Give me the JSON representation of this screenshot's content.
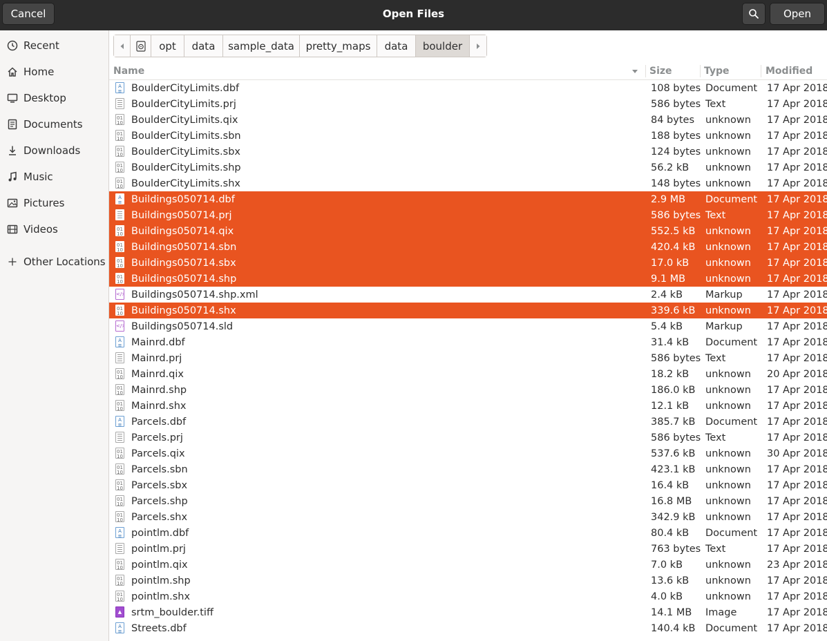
{
  "window": {
    "title": "Open Files",
    "cancel_label": "Cancel",
    "open_label": "Open"
  },
  "sidebar": {
    "items": [
      {
        "label": "Recent",
        "icon": "clock-icon"
      },
      {
        "label": "Home",
        "icon": "home-icon"
      },
      {
        "label": "Desktop",
        "icon": "desktop-icon"
      },
      {
        "label": "Documents",
        "icon": "documents-icon"
      },
      {
        "label": "Downloads",
        "icon": "download-icon"
      },
      {
        "label": "Music",
        "icon": "music-icon"
      },
      {
        "label": "Pictures",
        "icon": "pictures-icon"
      },
      {
        "label": "Videos",
        "icon": "videos-icon"
      },
      {
        "label": "Other Locations",
        "icon": "plus-icon"
      }
    ]
  },
  "path": {
    "crumbs": [
      "opt",
      "data",
      "sample_data",
      "pretty_maps",
      "data",
      "boulder"
    ]
  },
  "columns": {
    "name": "Name",
    "size": "Size",
    "type": "Type",
    "modified": "Modified"
  },
  "files": [
    {
      "name": "BoulderCityLimits.dbf",
      "size": "108 bytes",
      "type": "Document",
      "modified": "17 Apr 2018",
      "icon": "doc",
      "selected": false
    },
    {
      "name": "BoulderCityLimits.prj",
      "size": "586 bytes",
      "type": "Text",
      "modified": "17 Apr 2018",
      "icon": "text",
      "selected": false
    },
    {
      "name": "BoulderCityLimits.qix",
      "size": "84 bytes",
      "type": "unknown",
      "modified": "17 Apr 2018",
      "icon": "binary",
      "selected": false
    },
    {
      "name": "BoulderCityLimits.sbn",
      "size": "188 bytes",
      "type": "unknown",
      "modified": "17 Apr 2018",
      "icon": "binary",
      "selected": false
    },
    {
      "name": "BoulderCityLimits.sbx",
      "size": "124 bytes",
      "type": "unknown",
      "modified": "17 Apr 2018",
      "icon": "binary",
      "selected": false
    },
    {
      "name": "BoulderCityLimits.shp",
      "size": "56.2 kB",
      "type": "unknown",
      "modified": "17 Apr 2018",
      "icon": "binary",
      "selected": false
    },
    {
      "name": "BoulderCityLimits.shx",
      "size": "148 bytes",
      "type": "unknown",
      "modified": "17 Apr 2018",
      "icon": "binary",
      "selected": false
    },
    {
      "name": "Buildings050714.dbf",
      "size": "2.9 MB",
      "type": "Document",
      "modified": "17 Apr 2018",
      "icon": "doc",
      "selected": true
    },
    {
      "name": "Buildings050714.prj",
      "size": "586 bytes",
      "type": "Text",
      "modified": "17 Apr 2018",
      "icon": "text",
      "selected": true
    },
    {
      "name": "Buildings050714.qix",
      "size": "552.5 kB",
      "type": "unknown",
      "modified": "17 Apr 2018",
      "icon": "binary",
      "selected": true
    },
    {
      "name": "Buildings050714.sbn",
      "size": "420.4 kB",
      "type": "unknown",
      "modified": "17 Apr 2018",
      "icon": "binary",
      "selected": true
    },
    {
      "name": "Buildings050714.sbx",
      "size": "17.0 kB",
      "type": "unknown",
      "modified": "17 Apr 2018",
      "icon": "binary",
      "selected": true
    },
    {
      "name": "Buildings050714.shp",
      "size": "9.1 MB",
      "type": "unknown",
      "modified": "17 Apr 2018",
      "icon": "binary",
      "selected": true
    },
    {
      "name": "Buildings050714.shp.xml",
      "size": "2.4 kB",
      "type": "Markup",
      "modified": "17 Apr 2018",
      "icon": "markup",
      "selected": false
    },
    {
      "name": "Buildings050714.shx",
      "size": "339.6 kB",
      "type": "unknown",
      "modified": "17 Apr 2018",
      "icon": "binary",
      "selected": true
    },
    {
      "name": "Buildings050714.sld",
      "size": "5.4 kB",
      "type": "Markup",
      "modified": "17 Apr 2018",
      "icon": "markup",
      "selected": false
    },
    {
      "name": "Mainrd.dbf",
      "size": "31.4 kB",
      "type": "Document",
      "modified": "17 Apr 2018",
      "icon": "doc",
      "selected": false
    },
    {
      "name": "Mainrd.prj",
      "size": "586 bytes",
      "type": "Text",
      "modified": "17 Apr 2018",
      "icon": "text",
      "selected": false
    },
    {
      "name": "Mainrd.qix",
      "size": "18.2 kB",
      "type": "unknown",
      "modified": "20 Apr 2018",
      "icon": "binary",
      "selected": false
    },
    {
      "name": "Mainrd.shp",
      "size": "186.0 kB",
      "type": "unknown",
      "modified": "17 Apr 2018",
      "icon": "binary",
      "selected": false
    },
    {
      "name": "Mainrd.shx",
      "size": "12.1 kB",
      "type": "unknown",
      "modified": "17 Apr 2018",
      "icon": "binary",
      "selected": false
    },
    {
      "name": "Parcels.dbf",
      "size": "385.7 kB",
      "type": "Document",
      "modified": "17 Apr 2018",
      "icon": "doc",
      "selected": false
    },
    {
      "name": "Parcels.prj",
      "size": "586 bytes",
      "type": "Text",
      "modified": "17 Apr 2018",
      "icon": "text",
      "selected": false
    },
    {
      "name": "Parcels.qix",
      "size": "537.6 kB",
      "type": "unknown",
      "modified": "30 Apr 2018",
      "icon": "binary",
      "selected": false
    },
    {
      "name": "Parcels.sbn",
      "size": "423.1 kB",
      "type": "unknown",
      "modified": "17 Apr 2018",
      "icon": "binary",
      "selected": false
    },
    {
      "name": "Parcels.sbx",
      "size": "16.4 kB",
      "type": "unknown",
      "modified": "17 Apr 2018",
      "icon": "binary",
      "selected": false
    },
    {
      "name": "Parcels.shp",
      "size": "16.8 MB",
      "type": "unknown",
      "modified": "17 Apr 2018",
      "icon": "binary",
      "selected": false
    },
    {
      "name": "Parcels.shx",
      "size": "342.9 kB",
      "type": "unknown",
      "modified": "17 Apr 2018",
      "icon": "binary",
      "selected": false
    },
    {
      "name": "pointlm.dbf",
      "size": "80.4 kB",
      "type": "Document",
      "modified": "17 Apr 2018",
      "icon": "doc",
      "selected": false
    },
    {
      "name": "pointlm.prj",
      "size": "763 bytes",
      "type": "Text",
      "modified": "17 Apr 2018",
      "icon": "text",
      "selected": false
    },
    {
      "name": "pointlm.qix",
      "size": "7.0 kB",
      "type": "unknown",
      "modified": "23 Apr 2018",
      "icon": "binary",
      "selected": false
    },
    {
      "name": "pointlm.shp",
      "size": "13.6 kB",
      "type": "unknown",
      "modified": "17 Apr 2018",
      "icon": "binary",
      "selected": false
    },
    {
      "name": "pointlm.shx",
      "size": "4.0 kB",
      "type": "unknown",
      "modified": "17 Apr 2018",
      "icon": "binary",
      "selected": false
    },
    {
      "name": "srtm_boulder.tiff",
      "size": "14.1 MB",
      "type": "Image",
      "modified": "17 Apr 2018",
      "icon": "image",
      "selected": false
    },
    {
      "name": "Streets.dbf",
      "size": "140.4 kB",
      "type": "Document",
      "modified": "17 Apr 2018",
      "icon": "doc",
      "selected": false
    }
  ],
  "colors": {
    "selection": "#e95420",
    "headerbar": "#2c2c2c"
  }
}
